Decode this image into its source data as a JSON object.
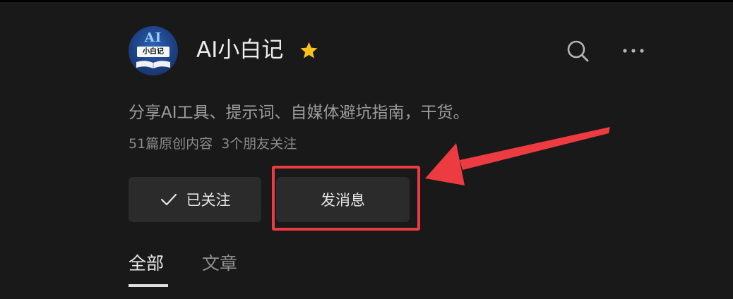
{
  "profile": {
    "avatar_text": "AI",
    "avatar_banner": "小白记",
    "name": "AI小白记",
    "verified_icon": "star-icon",
    "description": "分享AI工具、提示词、自媒体避坑指南，干货。",
    "stats": {
      "articles": "51篇原创内容",
      "friends": "3个朋友关注"
    }
  },
  "toolbar": {
    "search_icon": "search-icon",
    "more_icon": "more-icon"
  },
  "actions": {
    "follow_label": "已关注",
    "message_label": "发消息"
  },
  "tabs": [
    {
      "label": "全部",
      "active": true
    },
    {
      "label": "文章",
      "active": false
    }
  ],
  "colors": {
    "background": "#191919",
    "accent_star": "#f7c21b",
    "annotation_red": "#ec3b41",
    "button_bg": "#2b2b2b"
  }
}
